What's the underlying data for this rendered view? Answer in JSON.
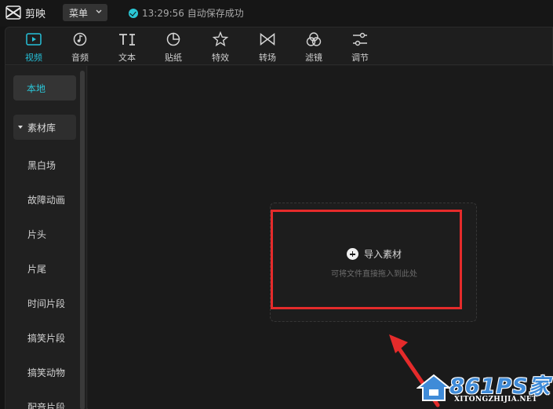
{
  "app": {
    "title": "剪映"
  },
  "menu": {
    "label": "菜单"
  },
  "save_status": {
    "text": "13:29:56 自动保存成功"
  },
  "tabs": [
    {
      "label": "视频",
      "icon": "video-icon",
      "active": true
    },
    {
      "label": "音频",
      "icon": "audio-icon",
      "active": false
    },
    {
      "label": "文本",
      "icon": "text-icon",
      "active": false
    },
    {
      "label": "贴纸",
      "icon": "sticker-icon",
      "active": false
    },
    {
      "label": "特效",
      "icon": "effects-icon",
      "active": false
    },
    {
      "label": "转场",
      "icon": "transition-icon",
      "active": false
    },
    {
      "label": "滤镜",
      "icon": "filter-icon",
      "active": false
    },
    {
      "label": "调节",
      "icon": "adjust-icon",
      "active": false
    }
  ],
  "sidebar": {
    "local": "本地",
    "library": "素材库",
    "items": [
      "黑白场",
      "故障动画",
      "片头",
      "片尾",
      "时间片段",
      "搞笑片段",
      "搞笑动物",
      "配音片段"
    ]
  },
  "import": {
    "label": "导入素材",
    "hint": "可将文件直接拖入到此处"
  },
  "watermark": {
    "brand": "861PS家",
    "url": "XITONGZHIJIA.NET"
  },
  "colors": {
    "accent": "#26c0d8",
    "highlight": "#e52b2b",
    "background": "#1a1a1a"
  }
}
